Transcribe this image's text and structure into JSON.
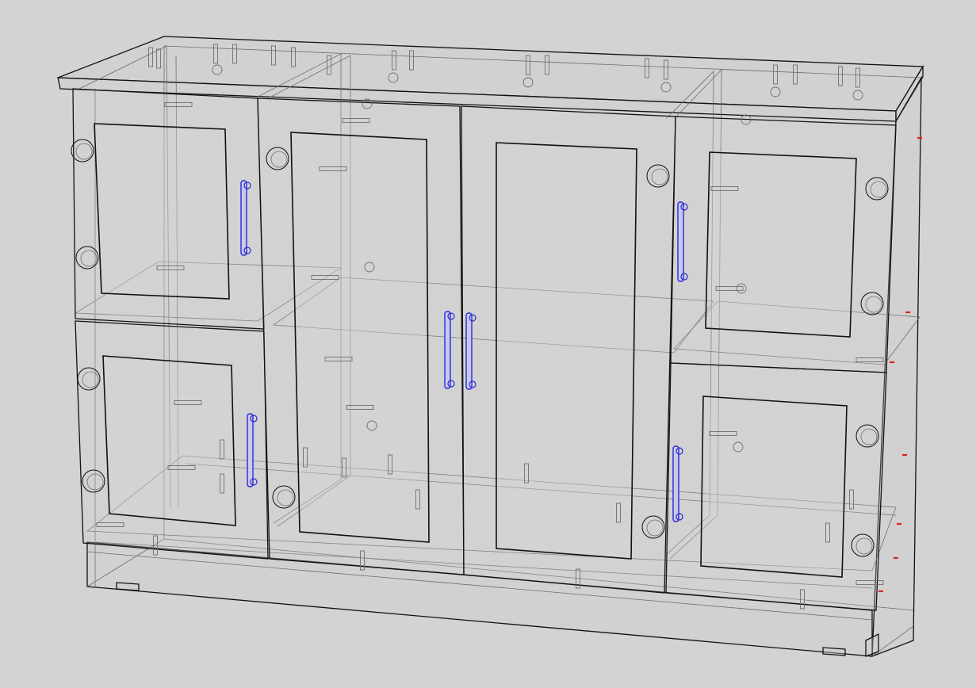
{
  "viewport": {
    "background": "#d3d3d3"
  },
  "model": {
    "render_style": "x-ray wireframe",
    "colors": {
      "edge": "#111111",
      "hidden_edge": "#6e6e6e",
      "handle": "#2a2ad6",
      "handle_fill": "#c9c9ef",
      "marker": "#e02020",
      "panel_fill": "#cfcfcf",
      "glass_fill": "#d6d6d6"
    },
    "parts": {
      "doors": 6,
      "glass_panes": 6,
      "handles": 6,
      "shelves": 3
    }
  }
}
